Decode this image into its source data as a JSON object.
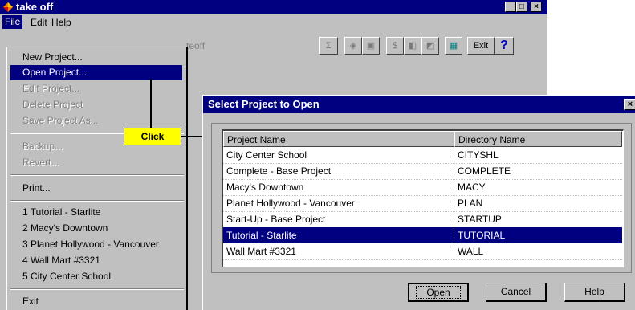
{
  "window": {
    "title": "take off",
    "minimize_label": "_",
    "maximize_label": "□",
    "close_label": "×"
  },
  "menubar": {
    "file": "File",
    "edit": "Edit",
    "help": "Help"
  },
  "toolbar": {
    "ghost_text": "teoff",
    "exit_label": "Exit",
    "help_label": "?"
  },
  "file_menu": {
    "items": [
      {
        "label": "New Project...",
        "enabled": true,
        "selected": false
      },
      {
        "label": "Open Project...",
        "enabled": true,
        "selected": true
      },
      {
        "label": "Edit Project...",
        "enabled": false,
        "selected": false
      },
      {
        "label": "Delete Project",
        "enabled": false,
        "selected": false
      },
      {
        "label": "Save Project As...",
        "enabled": false,
        "selected": false
      },
      {
        "label": "Backup...",
        "enabled": false,
        "selected": false
      },
      {
        "label": "Revert...",
        "enabled": false,
        "selected": false
      },
      {
        "label": "Print...",
        "enabled": true,
        "selected": false
      },
      {
        "label": "1 Tutorial - Starlite",
        "enabled": true,
        "selected": false
      },
      {
        "label": "2 Macy's Downtown",
        "enabled": true,
        "selected": false
      },
      {
        "label": "3 Planet Hollywood - Vancouver",
        "enabled": true,
        "selected": false
      },
      {
        "label": "4 Wall Mart #3321",
        "enabled": true,
        "selected": false
      },
      {
        "label": "5 City Center School",
        "enabled": true,
        "selected": false
      },
      {
        "label": "Exit",
        "enabled": true,
        "selected": false
      }
    ]
  },
  "callout": {
    "label": "Click"
  },
  "dialog": {
    "title": "Select Project to Open",
    "close_label": "×",
    "columns": [
      "Project Name",
      "Directory Name"
    ],
    "rows": [
      {
        "name": "City Center School",
        "dir": "CITYSHL",
        "selected": false
      },
      {
        "name": "Complete - Base Project",
        "dir": "COMPLETE",
        "selected": false
      },
      {
        "name": "Macy's Downtown",
        "dir": "MACY",
        "selected": false
      },
      {
        "name": "Planet Hollywood - Vancouver",
        "dir": "PLAN",
        "selected": false
      },
      {
        "name": "Start-Up - Base Project",
        "dir": "STARTUP",
        "selected": false
      },
      {
        "name": "Tutorial - Starlite",
        "dir": "TUTORIAL",
        "selected": true
      },
      {
        "name": "Wall Mart #3321",
        "dir": "WALL",
        "selected": false
      }
    ],
    "buttons": {
      "open": "Open",
      "cancel": "Cancel",
      "help": "Help"
    }
  },
  "colors": {
    "title_bar": "#000080",
    "selection": "#000080",
    "face": "#c0c0c0",
    "callout": "#ffff00"
  }
}
